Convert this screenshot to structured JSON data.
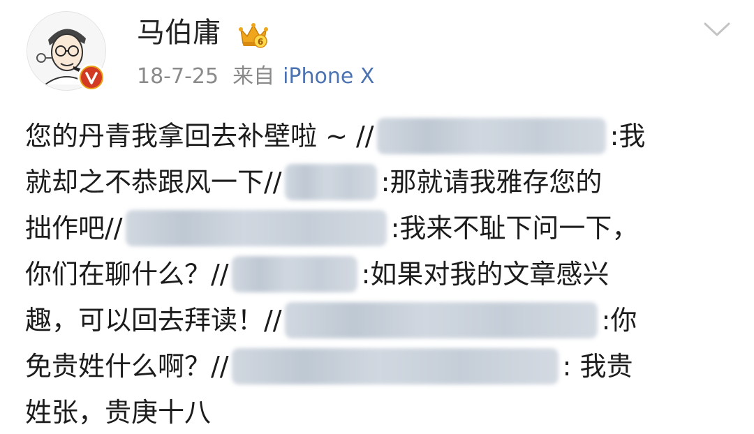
{
  "header": {
    "username": "马伯庸",
    "date": "18-7-25",
    "source_prefix": "来自",
    "source_device": "iPhone X",
    "avatar_icon": "cartoon-portrait-avatar",
    "verified_icon": "verified-v-icon",
    "member_icon": "crown-member-badge-icon",
    "member_level": "6",
    "expand_icon": "chevron-down-icon"
  },
  "post": {
    "lines": [
      {
        "text_before": "您的丹青我拿回去补壁啦 ~ //",
        "text_after": ":我"
      },
      {
        "text_before": "就却之不恭跟风一下//",
        "text_after": ":那就请我雅存您的"
      },
      {
        "text_before": "拙作吧//",
        "text_after": ":我来不耻下问一下，"
      },
      {
        "text_before": "你们在聊什么？//",
        "text_after": ":如果对我的文章感兴"
      },
      {
        "text_before": "趣，可以回去拜读！//",
        "text_after": ":你"
      },
      {
        "text_before": "免贵姓什么啊？//",
        "text_after": ": 我贵"
      },
      {
        "text_before": "姓张，贵庚十八",
        "text_after": ""
      }
    ]
  },
  "colors": {
    "text": "#1c1c1c",
    "meta": "#8a8a8a",
    "source_link": "#4b73b2",
    "badge_orange": "#e8a21a",
    "badge_red": "#d23a23"
  }
}
